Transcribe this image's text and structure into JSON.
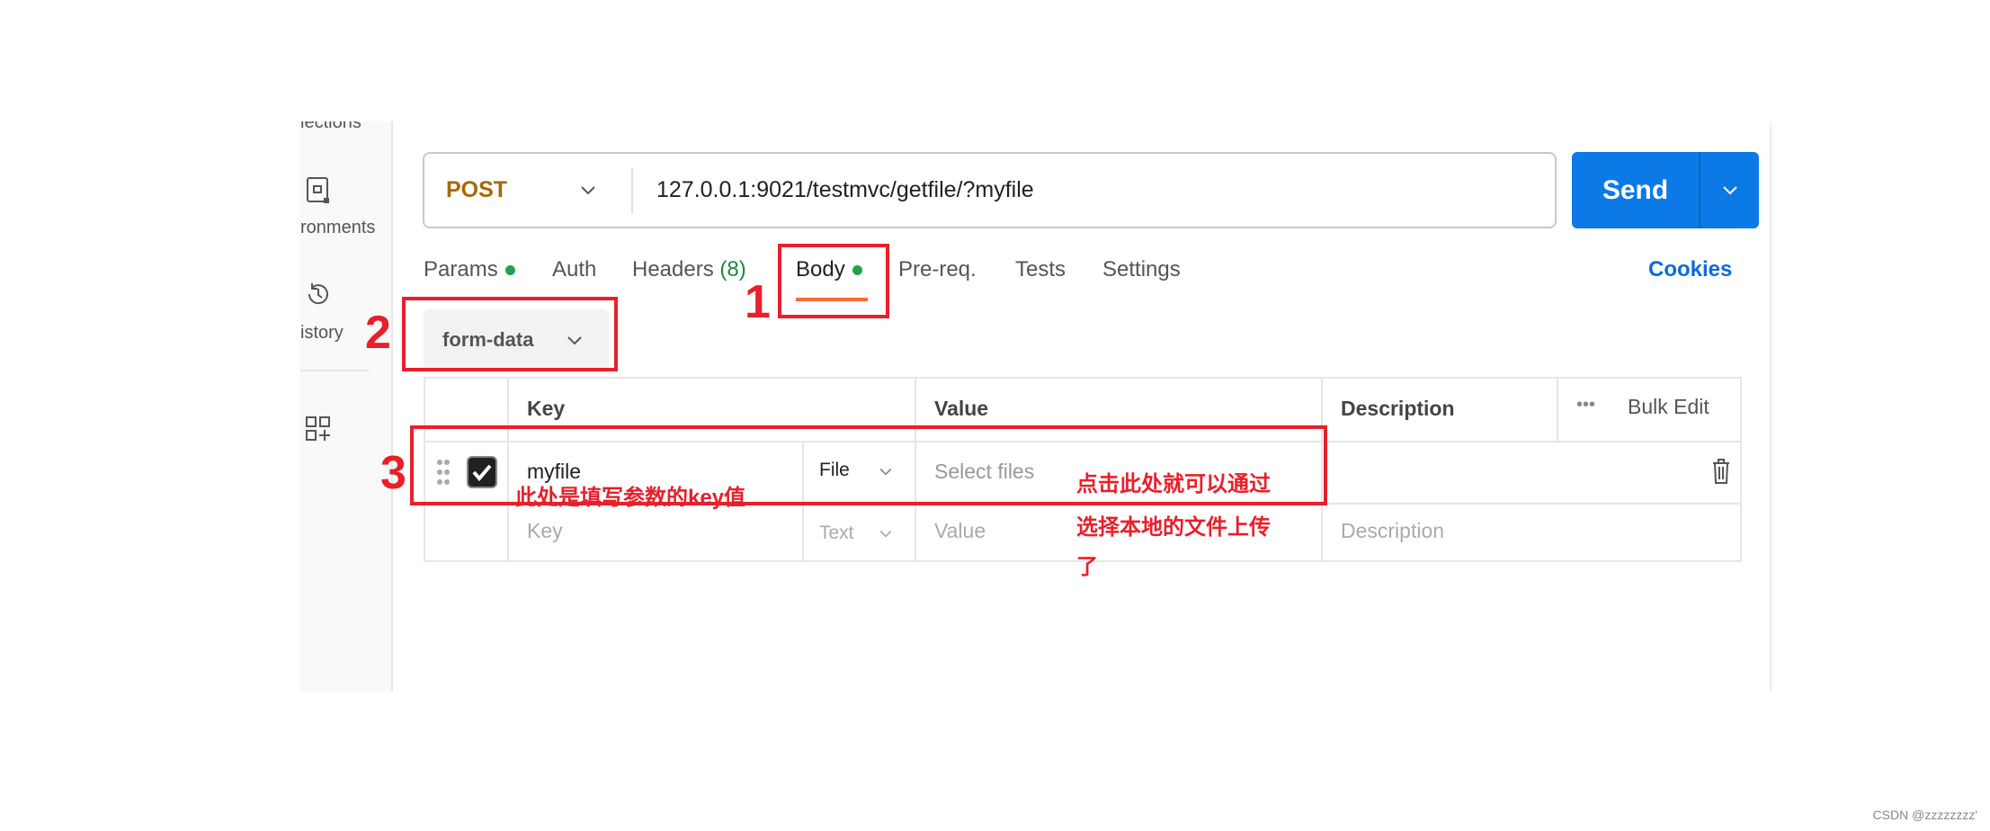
{
  "sidebar": {
    "items": [
      {
        "label": "lections",
        "icon": "collections-icon"
      },
      {
        "label": "ronments",
        "icon": "environment-icon"
      },
      {
        "label": "istory",
        "icon": "history-icon"
      },
      {
        "label": "",
        "icon": "add-workspace-grid-icon"
      }
    ]
  },
  "request": {
    "method": "POST",
    "url": "127.0.0.1:9021/testmvc/getfile/?myfile",
    "send_label": "Send"
  },
  "tabs": [
    {
      "label": "Params",
      "dot": true
    },
    {
      "label": "Auth"
    },
    {
      "label": "Headers",
      "count": "(8)"
    },
    {
      "label": "Body",
      "dot": true,
      "active": true
    },
    {
      "label": "Pre-req."
    },
    {
      "label": "Tests"
    },
    {
      "label": "Settings"
    }
  ],
  "cookies_label": "Cookies",
  "body_type": "form-data",
  "table": {
    "headers": {
      "key": "Key",
      "value": "Value",
      "description": "Description",
      "bulk_edit": "Bulk Edit"
    },
    "rows": [
      {
        "checked": true,
        "key": "myfile",
        "type": "File",
        "value": "Select files",
        "description": ""
      }
    ],
    "new_row": {
      "key": "Key",
      "type": "Text",
      "value": "Value",
      "description": "Description"
    }
  },
  "annotations": {
    "n1": "1",
    "n2": "2",
    "n3": "3",
    "key_note": "此处是填写参数的key值",
    "value_note_1": "点击此处就可以通过",
    "value_note_2": "选择本地的文件上传",
    "value_note_3": "了",
    "color": "#e8202a"
  },
  "colors": {
    "accent": "#ff6c37",
    "send": "#0c7ae6",
    "method": "#a66a00",
    "dot": "#1fa34a"
  },
  "watermark": "CSDN @zzzzzzzz'"
}
